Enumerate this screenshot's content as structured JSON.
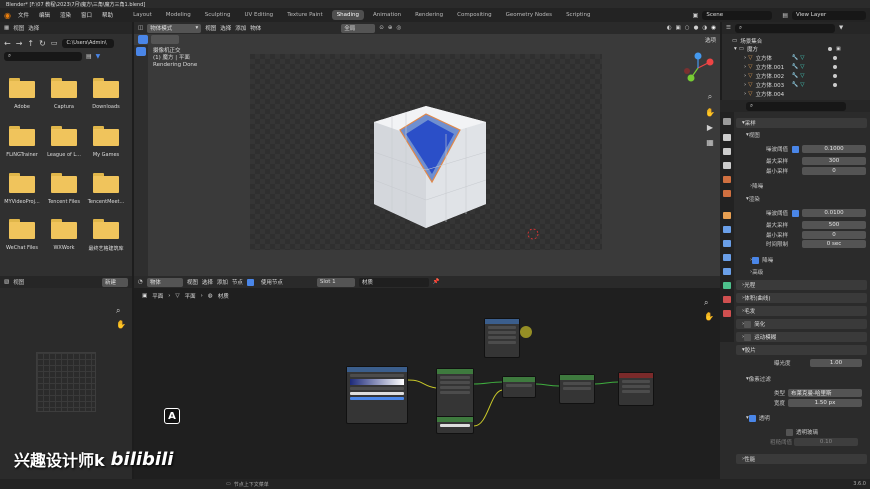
{
  "title_bar": {
    "text": "Blender* [F:\\07 教程\\2023\\7月\\魔方\\三角\\魔方三角1.blend]"
  },
  "top_menu": [
    "文件",
    "编辑",
    "渲染",
    "窗口",
    "帮助"
  ],
  "workspaces": [
    "Layout",
    "Modeling",
    "Sculpting",
    "UV Editing",
    "Texture Paint",
    "Shading",
    "Animation",
    "Rendering",
    "Compositing",
    "Geometry Nodes",
    "Scripting"
  ],
  "active_workspace": "Shading",
  "scene": {
    "label": "Scene",
    "view_layer": "View Layer"
  },
  "file_browser": {
    "menus": [
      "视图",
      "选择"
    ],
    "path": "C:\\Users\\Admin\\",
    "items": [
      "Adobe",
      "Captura",
      "Downloads",
      "FLiNGTrainer",
      "League of L...",
      "My Games",
      "MYVideoProj...",
      "Tencent Files",
      "TencentMeet...",
      "WeChat Files",
      "WXWork",
      "最终艺格建筑库"
    ]
  },
  "viewport": {
    "mode": "物体模式",
    "menus": [
      "视图",
      "选择",
      "添加",
      "物体"
    ],
    "transform": "全局",
    "camera_label": "摄像机正交",
    "collection_label": "(1) 魔方 | 平面",
    "status": "Rendering Done",
    "options": "选项"
  },
  "image_editor": {
    "menus": [
      "视图"
    ],
    "new_button": "新建"
  },
  "node_editor": {
    "type": "物体",
    "menus": [
      "视图",
      "选择",
      "添加",
      "节点"
    ],
    "use_nodes": "使用节点",
    "slot": "Slot 1",
    "material": "材质",
    "breadcrumb": [
      "平面",
      "平面",
      "材质"
    ]
  },
  "outliner": {
    "title": "场景集合",
    "collection": "魔方",
    "objects": [
      "立方体",
      "立方体.001",
      "立方体.002",
      "立方体.003",
      "立方体.004"
    ]
  },
  "properties": {
    "sampling": "采样",
    "viewport": "视图",
    "noise_threshold": "噪波阈值",
    "max_samples": "最大采样",
    "min_samples": "最小采样",
    "vp_noise_value": "0.1000",
    "vp_max_value": "300",
    "vp_min_value": "0",
    "denoise": "降噪",
    "render": "渲染",
    "r_noise_value": "0.0100",
    "r_max_value": "500",
    "r_min_value": "0",
    "time_limit": "时间限制",
    "time_value": "0 sec",
    "denoise2": "降噪",
    "advanced": "高级",
    "light_paths": "光程",
    "volumes": "体积(曲线)",
    "hair": "毛发",
    "simplify": "简化",
    "motion_blur": "运动模糊",
    "film": "胶片",
    "exposure": "曝光度",
    "exposure_value": "1.00",
    "pixel_filter": "像素过滤",
    "filter_type": "类型",
    "filter_type_value": "布莱克曼-哈里斯",
    "width": "宽度",
    "width_value": "1.50 px",
    "transparent": "透明",
    "transparent_glass": "透明玻璃",
    "roughness_threshold": "粗糙阈值",
    "roughness_value": "0.10",
    "performance": "性能"
  },
  "status_bar": {
    "hint": "节点上下文菜单",
    "version": "3.6.0"
  },
  "watermark": {
    "text": "兴趣设计师k",
    "logo": "bilibili"
  },
  "key_overlay": "A"
}
